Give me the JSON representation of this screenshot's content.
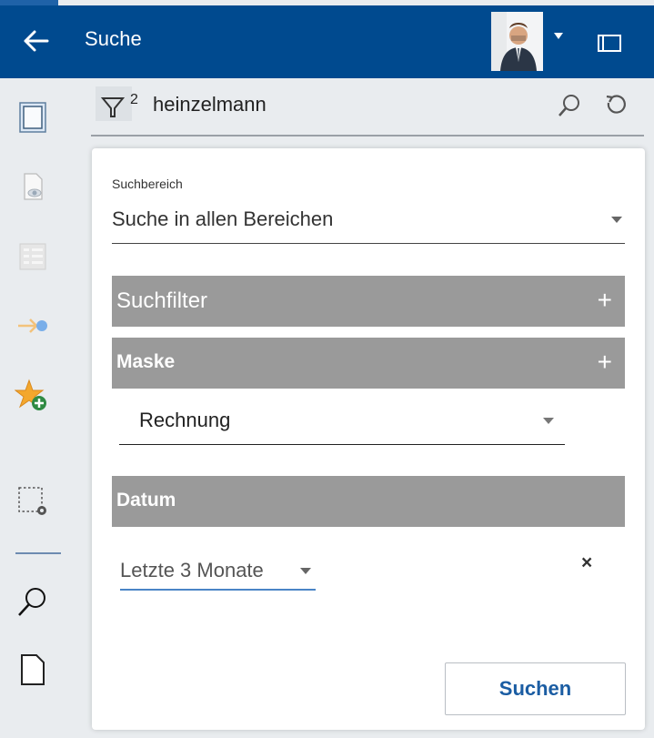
{
  "header": {
    "title": "Suche",
    "background_color": "#004a8f",
    "back_icon": "arrow-left-icon",
    "panel_icon": "panel-toggle-icon"
  },
  "search": {
    "query": "heinzelmann",
    "filter_count": "2",
    "filter_icon": "filter-icon",
    "search_icon": "search-icon",
    "reset_icon": "reset-icon"
  },
  "sidebar": {
    "items": [
      {
        "icon": "document-icon"
      },
      {
        "icon": "document-preview-icon"
      },
      {
        "icon": "list-view-icon"
      },
      {
        "icon": "arrow-workflow-icon"
      },
      {
        "icon": "star-add-icon"
      },
      {
        "icon": "selection-settings-icon"
      },
      {
        "icon": "search-icon"
      },
      {
        "icon": "new-document-icon"
      }
    ]
  },
  "form": {
    "scope_label": "Suchbereich",
    "scope_value": "Suche in allen Bereichen",
    "sections": {
      "filter": "Suchfilter",
      "mask": "Maske",
      "date": "Datum"
    },
    "mask_value": "Rechnung",
    "date_value": "Letzte 3 Monate",
    "date_clear": "×",
    "submit": "Suchen"
  },
  "colors": {
    "accent": "#1b5da3",
    "section_bg": "#9a9a9a",
    "divider": "#6d8bb1",
    "date_underline": "#4a84c6"
  }
}
